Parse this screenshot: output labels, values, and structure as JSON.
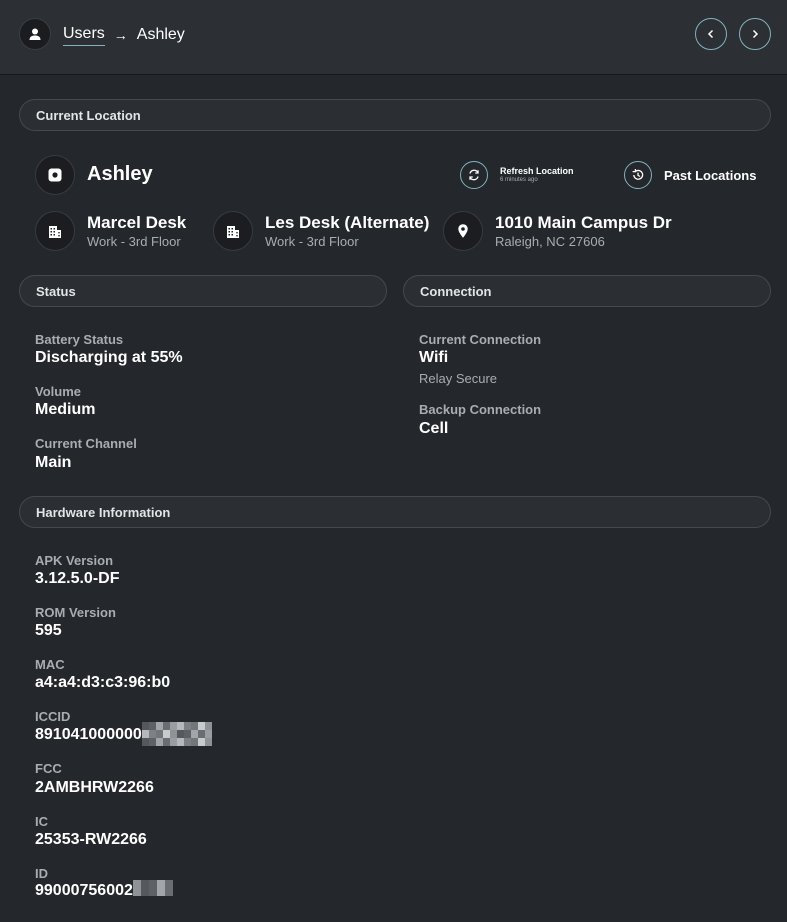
{
  "header": {
    "breadcrumb_root": "Users",
    "breadcrumb_separator": "→",
    "breadcrumb_current": "Ashley"
  },
  "current_location": {
    "section_title": "Current Location",
    "user_name": "Ashley",
    "refresh_label": "Refresh Location",
    "refresh_time": "6 minutes ago",
    "past_locations_label": "Past Locations",
    "places": [
      {
        "name": "Marcel Desk",
        "detail": "Work - 3rd Floor",
        "icon": "building-icon"
      },
      {
        "name": "Les Desk (Alternate)",
        "detail": "Work - 3rd Floor",
        "icon": "building-icon"
      },
      {
        "name": "1010 Main Campus Dr",
        "detail": "Raleigh, NC 27606",
        "icon": "map-pin-icon"
      }
    ]
  },
  "status": {
    "section_title": "Status",
    "fields": [
      {
        "label": "Battery Status",
        "value": "Discharging at 55%"
      },
      {
        "label": "Volume",
        "value": "Medium"
      },
      {
        "label": "Current Channel",
        "value": "Main"
      }
    ]
  },
  "connection": {
    "section_title": "Connection",
    "current_label": "Current Connection",
    "current_value": "Wifi",
    "current_detail": "Relay Secure",
    "backup_label": "Backup Connection",
    "backup_value": "Cell"
  },
  "hardware": {
    "section_title": "Hardware Information",
    "fields": [
      {
        "label": "APK Version",
        "value": "3.12.5.0-DF"
      },
      {
        "label": "ROM Version",
        "value": "595"
      },
      {
        "label": "MAC",
        "value": "a4:a4:d3:c3:96:b0"
      },
      {
        "label": "ICCID",
        "value": "891041000000"
      },
      {
        "label": "FCC",
        "value": "2AMBHRW2266"
      },
      {
        "label": "IC",
        "value": "25353-RW2266"
      },
      {
        "label": "ID",
        "value": "99000756002"
      }
    ]
  },
  "colors": {
    "accent": "#7fb4bd",
    "background": "#24272b",
    "header": "#2c2f33"
  }
}
